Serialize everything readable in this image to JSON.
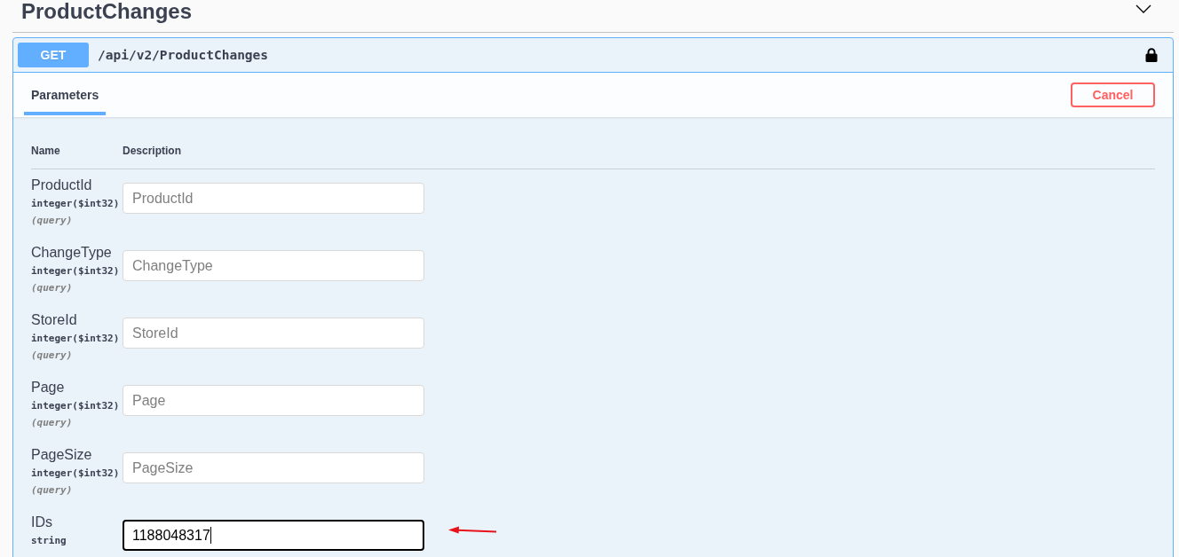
{
  "section": {
    "title": "ProductChanges"
  },
  "operation": {
    "method": "GET",
    "path": "/api/v2/ProductChanges"
  },
  "tabs": [
    {
      "label": "Parameters",
      "selected": true
    }
  ],
  "cancel_button": {
    "label": "Cancel"
  },
  "parameters": {
    "columns": [
      "Name",
      "Description"
    ],
    "rows": [
      {
        "name": "ProductId",
        "type": "integer($int32)",
        "location": "(query)",
        "placeholder": "ProductId",
        "focused": false
      },
      {
        "name": "ChangeType",
        "type": "integer($int32)",
        "location": "(query)",
        "placeholder": "ChangeType",
        "focused": false
      },
      {
        "name": "StoreId",
        "type": "integer($int32)",
        "location": "(query)",
        "placeholder": "StoreId",
        "focused": false
      },
      {
        "name": "Page",
        "type": "integer($int32)",
        "location": "(query)",
        "placeholder": "Page",
        "focused": false
      },
      {
        "name": "PageSize",
        "type": "integer($int32)",
        "location": "(query)",
        "placeholder": "PageSize",
        "focused": false
      },
      {
        "name": "IDs",
        "type": "string",
        "value": "1188048317",
        "focused": true
      }
    ]
  }
}
